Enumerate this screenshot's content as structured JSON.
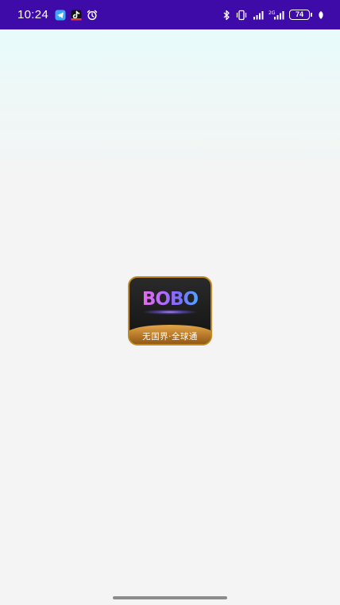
{
  "status_bar": {
    "time": "10:24",
    "left_icons": [
      "telegram-icon",
      "tiktok-icon",
      "alarm-icon"
    ],
    "right_icons": [
      "bluetooth-icon",
      "vibrate-icon",
      "signal-4g-icon",
      "signal-5g-icon"
    ],
    "network_label": "2G",
    "battery_level": "74",
    "colors": {
      "background": "#3e0aa8",
      "foreground": "#ffffff"
    }
  },
  "splash": {
    "logo": {
      "wordmark": "BOBO",
      "tagline": "无国界·全球通",
      "colors": {
        "border": "#c08a24",
        "banner": "#b47627",
        "background": "#1a1a1a"
      }
    },
    "background_color": "#f4f4f4"
  },
  "nav_bar": {
    "indicator_color": "#8c8c8c"
  }
}
